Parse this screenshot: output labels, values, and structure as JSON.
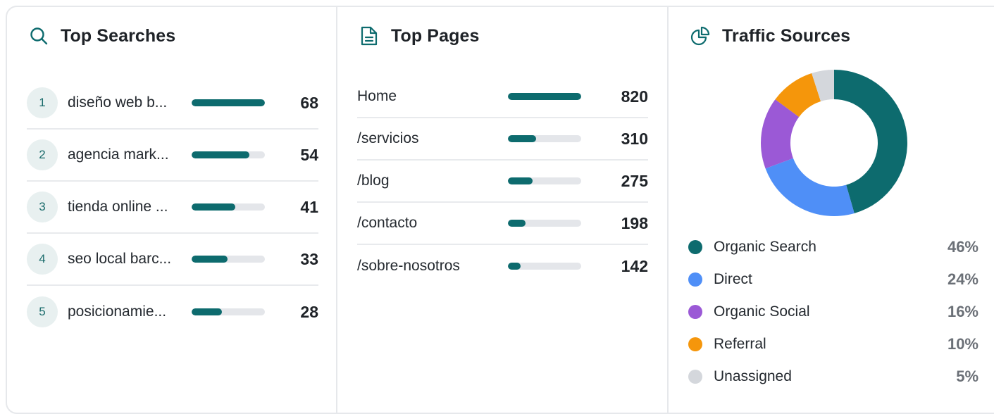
{
  "top_searches": {
    "title": "Top Searches",
    "icon": "search-icon",
    "items": [
      {
        "rank": "1",
        "term": "diseño web b...",
        "count": "68",
        "share": 1.0
      },
      {
        "rank": "2",
        "term": "agencia mark...",
        "count": "54",
        "share": 0.79
      },
      {
        "rank": "3",
        "term": "tienda online ...",
        "count": "41",
        "share": 0.6
      },
      {
        "rank": "4",
        "term": "seo local barc...",
        "count": "33",
        "share": 0.49
      },
      {
        "rank": "5",
        "term": "posicionamie...",
        "count": "28",
        "share": 0.41
      }
    ]
  },
  "top_pages": {
    "title": "Top Pages",
    "icon": "document-icon",
    "items": [
      {
        "path": "Home",
        "count": "820",
        "share": 1.0
      },
      {
        "path": "/servicios",
        "count": "310",
        "share": 0.38
      },
      {
        "path": "/blog",
        "count": "275",
        "share": 0.34
      },
      {
        "path": "/contacto",
        "count": "198",
        "share": 0.24
      },
      {
        "path": "/sobre-nosotros",
        "count": "142",
        "share": 0.17
      }
    ]
  },
  "traffic_sources": {
    "title": "Traffic Sources",
    "icon": "pie-chart-icon",
    "items": [
      {
        "label": "Organic Search",
        "pct": "46%",
        "value": 46,
        "color": "#0d6b6e"
      },
      {
        "label": "Direct",
        "pct": "24%",
        "value": 24,
        "color": "#4f8ff7"
      },
      {
        "label": "Organic Social",
        "pct": "16%",
        "value": 16,
        "color": "#9b59d6"
      },
      {
        "label": "Referral",
        "pct": "10%",
        "value": 10,
        "color": "#f5960b"
      },
      {
        "label": "Unassigned",
        "pct": "5%",
        "value": 5,
        "color": "#d4d7dc"
      }
    ]
  },
  "colors": {
    "accent": "#0d6b6e",
    "track": "#e4e6ea"
  }
}
